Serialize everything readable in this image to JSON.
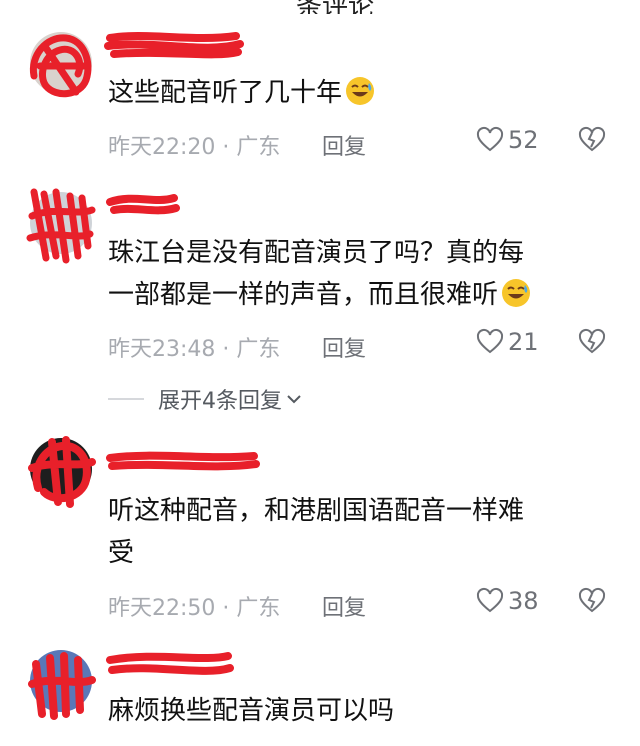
{
  "header": {
    "title_partial": "条评论"
  },
  "comments": [
    {
      "text": "这些配音听了几十年",
      "emoji": "grinning-sweat-emoji",
      "time": "昨天22:20 · 广东",
      "reply": "回复",
      "likes": "52"
    },
    {
      "text_line1": "珠江台是没有配音演员了吗？真的每",
      "text_line2": "一部都是一样的声音，而且很难听",
      "emoji": "grinning-sweat-emoji",
      "time": "昨天23:48 · 广东",
      "reply": "回复",
      "likes": "21"
    },
    {
      "text_line1": "听这种配音，和港剧国语配音一样难",
      "text_line2": "受",
      "time": "昨天22:50 · 广东",
      "reply": "回复",
      "likes": "38"
    },
    {
      "text": "麻烦换些配音演员可以吗"
    }
  ],
  "expand_replies": {
    "label": "展开4条回复"
  },
  "colors": {
    "redaction": "#e8202a",
    "meta_gray": "#a7aab0",
    "text": "#111111"
  }
}
